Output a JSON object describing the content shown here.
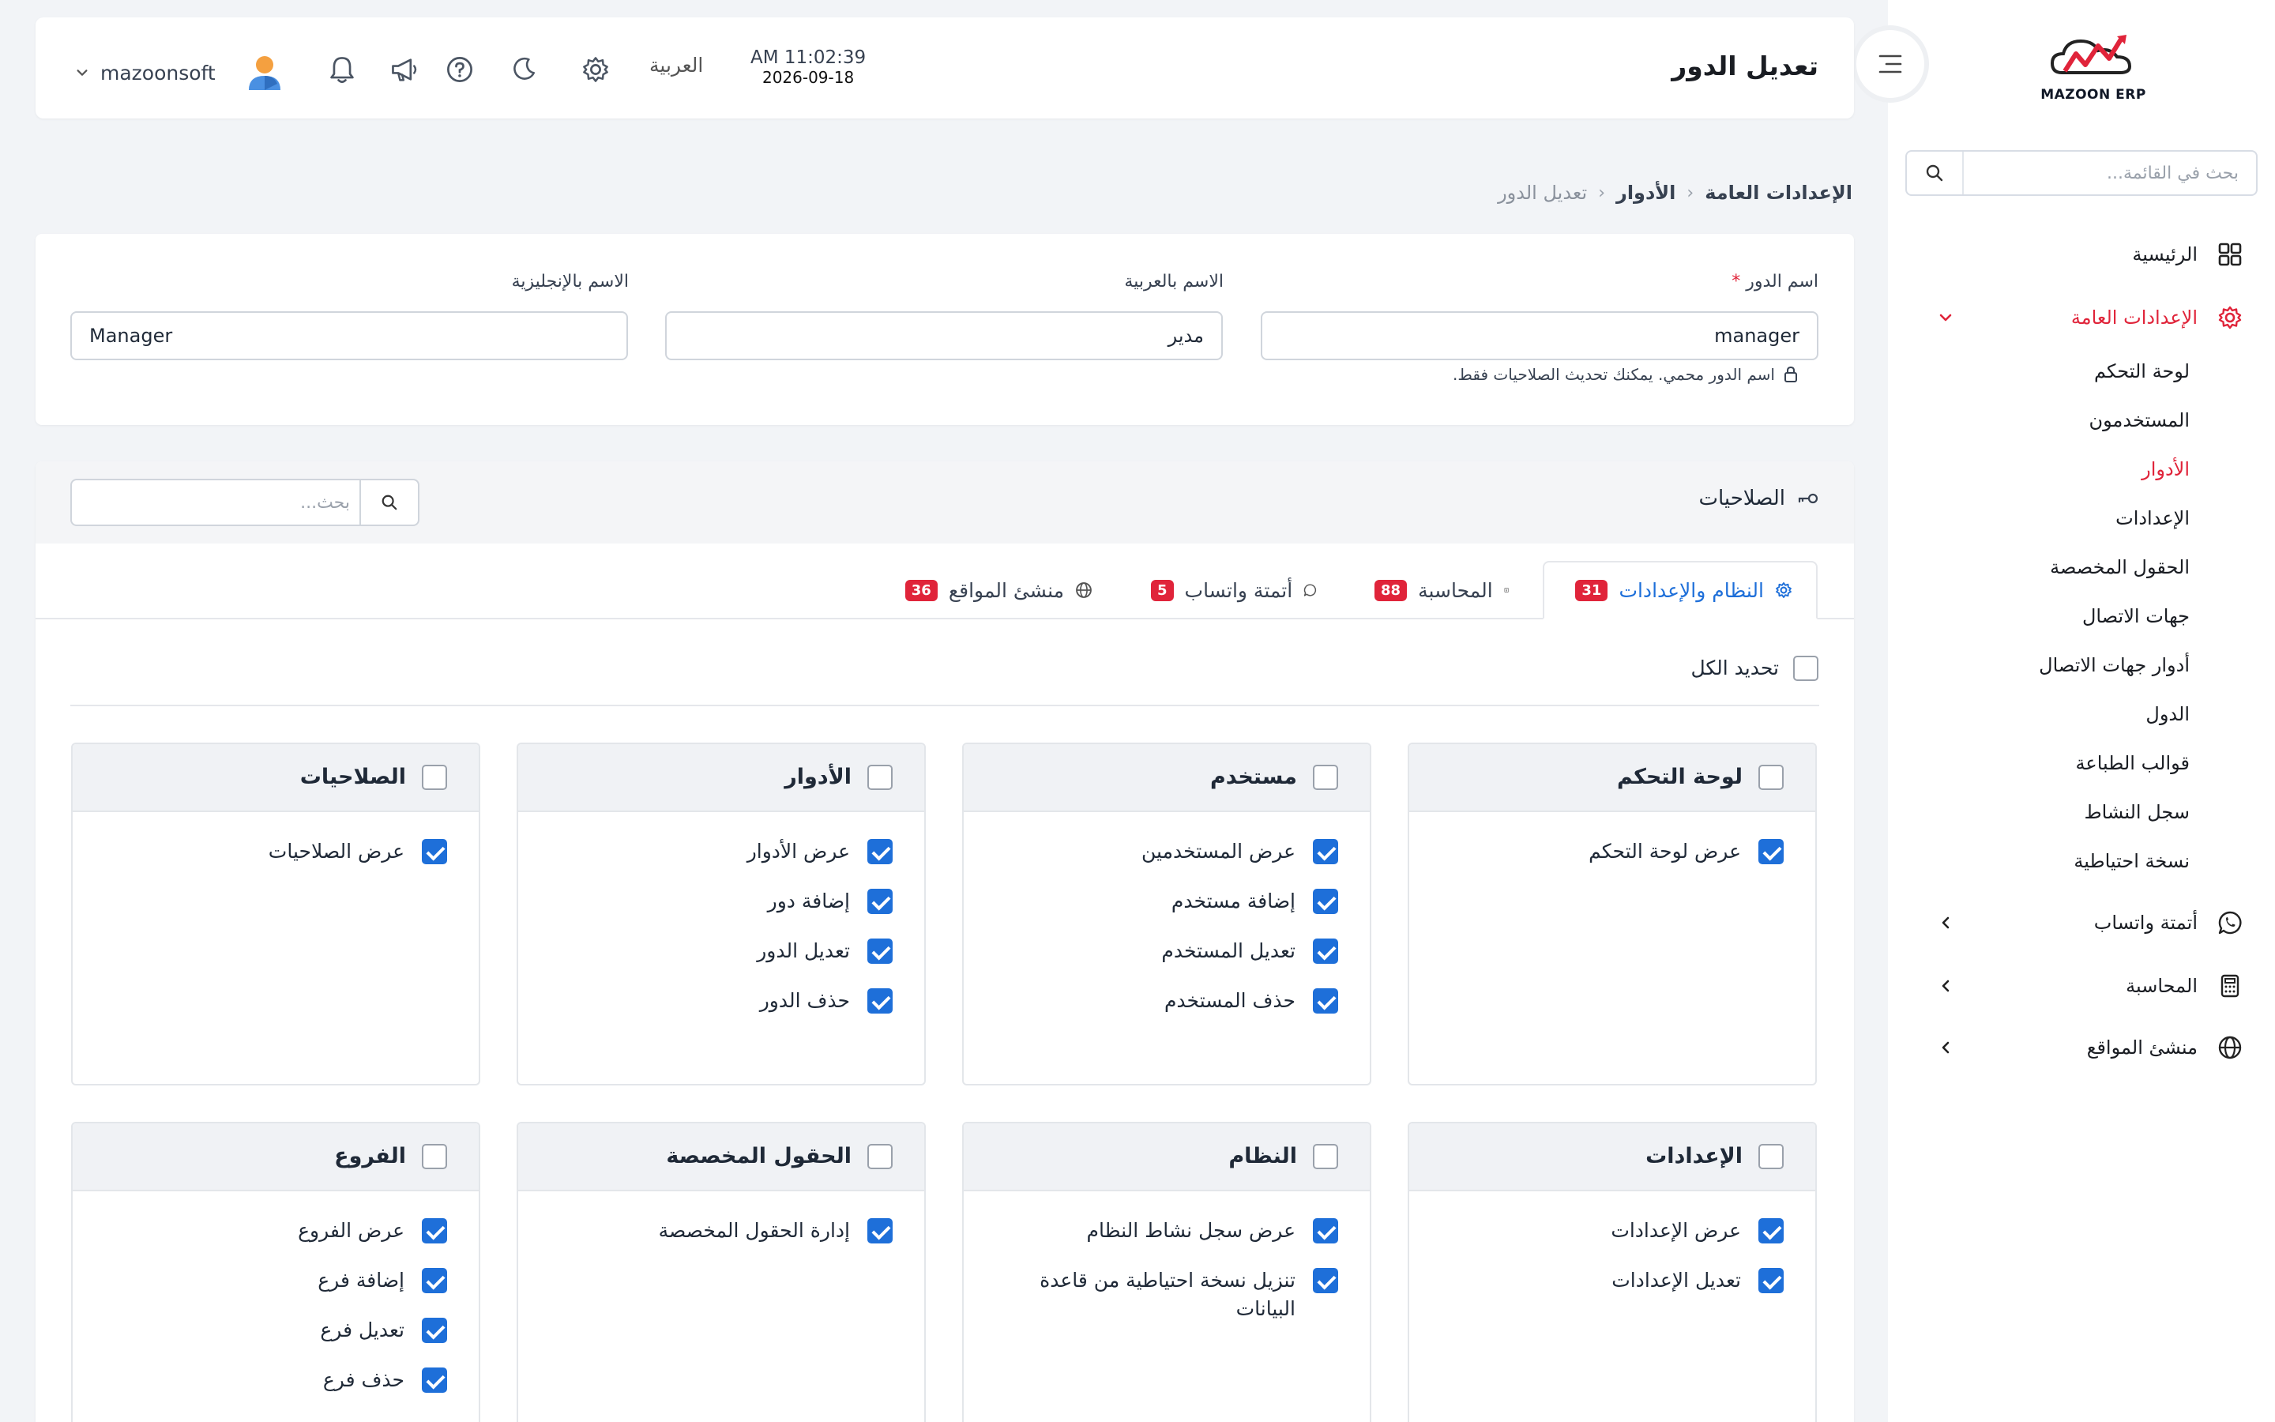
{
  "sidebar": {
    "logo_text": "MAZOON ERP",
    "search_placeholder": "بحث في القائمة...",
    "home": "الرئيسية",
    "general_settings": "الإعدادات العامة",
    "sub_items": [
      "لوحة التحكم",
      "المستخدمون",
      "الأدوار",
      "الإعدادات",
      "الحقول المخصصة",
      "جهات الاتصال",
      "أدوار جهات الاتصال",
      "الدول",
      "قوالب الطباعة",
      "سجل النشاط",
      "نسخة احتياطية"
    ],
    "whatsapp": "أتمتة واتساب",
    "accounting": "المحاسبة",
    "site_builder": "منشئ المواقع",
    "colors": {
      "accent": "#e0243a",
      "active_tab": "#1e6fd9"
    }
  },
  "header": {
    "title": "تعديل الدور",
    "time": "AM 11:02:39",
    "date": "2026-09-18",
    "language": "العربية",
    "username": "mazoonsoft"
  },
  "breadcrumb": {
    "b1": "الإعدادات العامة",
    "b2": "الأدوار",
    "b3": "تعديل الدور"
  },
  "form": {
    "role_name_label": "اسم الدور",
    "role_name_required": "*",
    "role_name_value": "manager",
    "arabic_name_label": "الاسم بالعربية",
    "arabic_name_value": "مدير",
    "english_name_label": "الاسم بالإنجليزية",
    "english_name_value": "Manager",
    "note": "اسم الدور محمي. يمكنك تحديث الصلاحيات فقط."
  },
  "permissions": {
    "title": "الصلاحيات",
    "search_placeholder": "بحث...",
    "select_all": "تحديد الكل",
    "tabs": [
      {
        "label": "النظام والإعدادات",
        "count": "31"
      },
      {
        "label": "المحاسبة",
        "count": "88"
      },
      {
        "label": "أتمتة واتساب",
        "count": "5"
      },
      {
        "label": "منشئ المواقع",
        "count": "36"
      }
    ],
    "groups": [
      {
        "title": "لوحة التحكم",
        "items": [
          "عرض لوحة التحكم"
        ]
      },
      {
        "title": "مستخدم",
        "items": [
          "عرض المستخدمين",
          "إضافة مستخدم",
          "تعديل المستخدم",
          "حذف المستخدم"
        ]
      },
      {
        "title": "الأدوار",
        "items": [
          "عرض الأدوار",
          "إضافة دور",
          "تعديل الدور",
          "حذف الدور"
        ]
      },
      {
        "title": "الصلاحيات",
        "items": [
          "عرض الصلاحيات"
        ]
      },
      {
        "title": "الإعدادات",
        "items": [
          "عرض الإعدادات",
          "تعديل الإعدادات"
        ]
      },
      {
        "title": "النظام",
        "items": [
          "عرض سجل نشاط النظام",
          "تنزيل نسخة احتياطية من قاعدة البيانات"
        ]
      },
      {
        "title": "الحقول المخصصة",
        "items": [
          "إدارة الحقول المخصصة"
        ]
      },
      {
        "title": "الفروع",
        "items": [
          "عرض الفروع",
          "إضافة فرع",
          "تعديل فرع",
          "حذف فرع"
        ]
      }
    ]
  }
}
